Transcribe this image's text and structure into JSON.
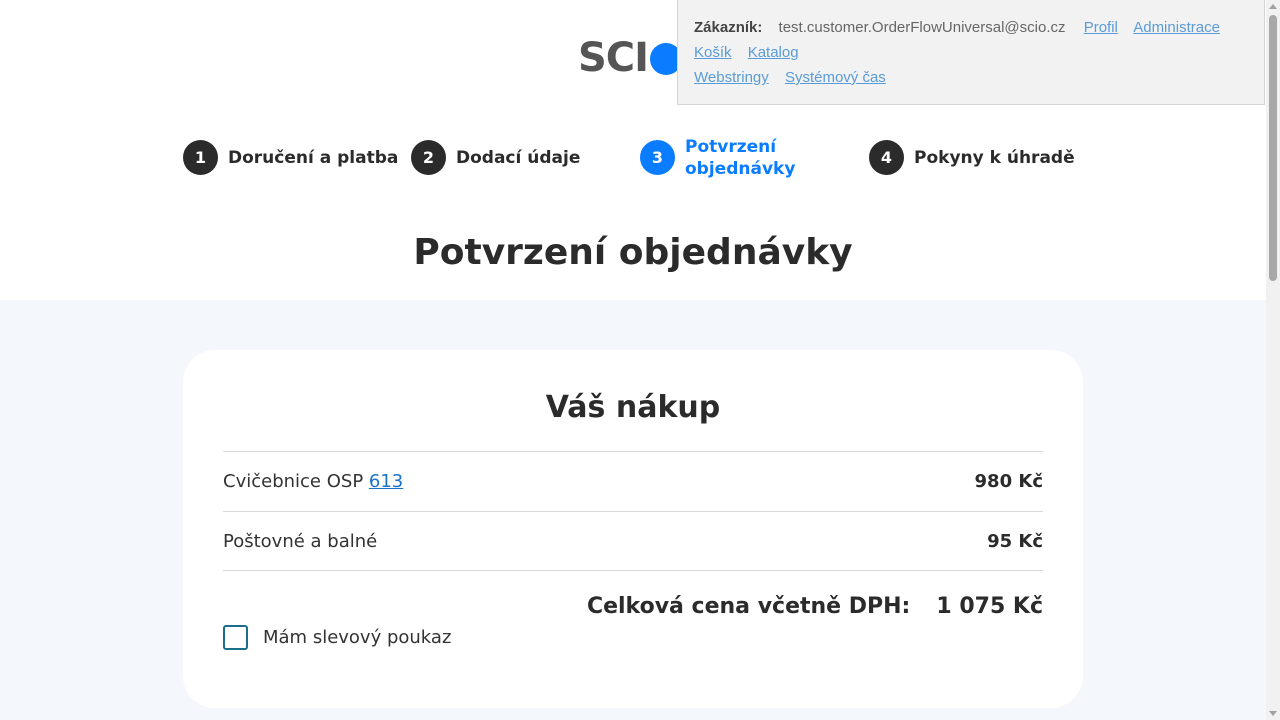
{
  "logo": {
    "text": "SCI",
    "dot_color": "#0a7cff"
  },
  "dev_panel": {
    "customer_label": "Zákazník:",
    "customer_email": "test.customer.OrderFlowUniversal@scio.cz",
    "links_row1": [
      "Profil",
      "Administrace"
    ],
    "links_row2": [
      "Košík",
      "Katalog"
    ],
    "links_row3": [
      "Webstringy",
      "Systémový čas"
    ]
  },
  "steps": [
    {
      "number": "1",
      "label": "Doručení a platba",
      "active": false
    },
    {
      "number": "2",
      "label": "Dodací údaje",
      "active": false
    },
    {
      "number": "3",
      "label": "Potvrzení objednávky",
      "active": true
    },
    {
      "number": "4",
      "label": "Pokyny k úhradě",
      "active": false
    }
  ],
  "page_title": "Potvrzení objednávky",
  "cart": {
    "title": "Váš nákup",
    "items": [
      {
        "name": "Cvičebnice OSP",
        "link": "613",
        "price": "980 Kč"
      },
      {
        "name": "Poštovné a balné",
        "link": "",
        "price": "95 Kč"
      }
    ],
    "total_label": "Celková cena včetně DPH:",
    "total_value": "1 075 Kč",
    "voucher_label": "Mám slevový poukaz",
    "voucher_checked": false
  },
  "colors": {
    "accent": "#0a7cff",
    "text": "#2b2b2b",
    "content_bg": "#f4f7fb"
  }
}
